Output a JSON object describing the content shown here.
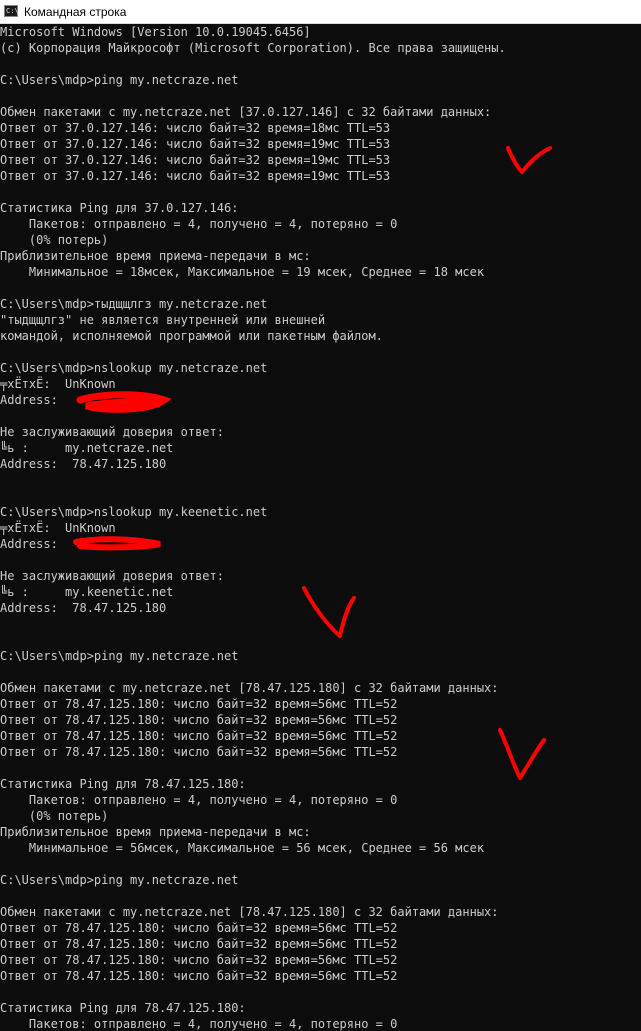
{
  "window": {
    "title": "Командная строка"
  },
  "console": {
    "lines": [
      "Microsoft Windows [Version 10.0.19045.6456]",
      "(c) Корпорация Майкрософт (Microsoft Corporation). Все права защищены.",
      "",
      "C:\\Users\\mdp>ping my.netcraze.net",
      "",
      "Обмен пакетами с my.netcraze.net [37.0.127.146] с 32 байтами данных:",
      "Ответ от 37.0.127.146: число байт=32 время=18мс TTL=53",
      "Ответ от 37.0.127.146: число байт=32 время=19мс TTL=53",
      "Ответ от 37.0.127.146: число байт=32 время=19мс TTL=53",
      "Ответ от 37.0.127.146: число байт=32 время=19мс TTL=53",
      "",
      "Статистика Ping для 37.0.127.146:",
      "    Пакетов: отправлено = 4, получено = 4, потеряно = 0",
      "    (0% потерь)",
      "Приблизительное время приема-передачи в мс:",
      "    Минимальное = 18мсек, Максимальное = 19 мсек, Среднее = 18 мсек",
      "",
      "C:\\Users\\mdp>тыдщщлгз my.netcraze.net",
      "\"тыдщщлгз\" не является внутренней или внешней",
      "командой, исполняемой программой или пакетным файлом.",
      "",
      "C:\\Users\\mdp>nslookup my.netcraze.net",
      "╤xЁтxЁ:  UnKnown",
      "Address:",
      "",
      "Не заслуживающий доверия ответ:",
      "╚ь :     my.netcraze.net",
      "Address:  78.47.125.180",
      "",
      "",
      "C:\\Users\\mdp>nslookup my.keenetic.net",
      "╤xЁтxЁ:  UnKnown",
      "Address:",
      "",
      "Не заслуживающий доверия ответ:",
      "╚ь :     my.keenetic.net",
      "Address:  78.47.125.180",
      "",
      "",
      "C:\\Users\\mdp>ping my.netcraze.net",
      "",
      "Обмен пакетами с my.netcraze.net [78.47.125.180] с 32 байтами данных:",
      "Ответ от 78.47.125.180: число байт=32 время=56мс TTL=52",
      "Ответ от 78.47.125.180: число байт=32 время=56мс TTL=52",
      "Ответ от 78.47.125.180: число байт=32 время=56мс TTL=52",
      "Ответ от 78.47.125.180: число байт=32 время=56мс TTL=52",
      "",
      "Статистика Ping для 78.47.125.180:",
      "    Пакетов: отправлено = 4, получено = 4, потеряно = 0",
      "    (0% потерь)",
      "Приблизительное время приема-передачи в мс:",
      "    Минимальное = 56мсек, Максимальное = 56 мсек, Среднее = 56 мсек",
      "",
      "C:\\Users\\mdp>ping my.netcraze.net",
      "",
      "Обмен пакетами с my.netcraze.net [78.47.125.180] с 32 байтами данных:",
      "Ответ от 78.47.125.180: число байт=32 время=56мс TTL=52",
      "Ответ от 78.47.125.180: число байт=32 время=56мс TTL=52",
      "Ответ от 78.47.125.180: число байт=32 время=56мс TTL=52",
      "Ответ от 78.47.125.180: число байт=32 время=56мс TTL=52",
      "",
      "Статистика Ping для 78.47.125.180:",
      "    Пакетов: отправлено = 4, получено = 4, потеряно = 0"
    ]
  },
  "colors": {
    "console_bg": "#0c0c0c",
    "console_text": "#cccccc",
    "annotation": "#ff0000"
  }
}
